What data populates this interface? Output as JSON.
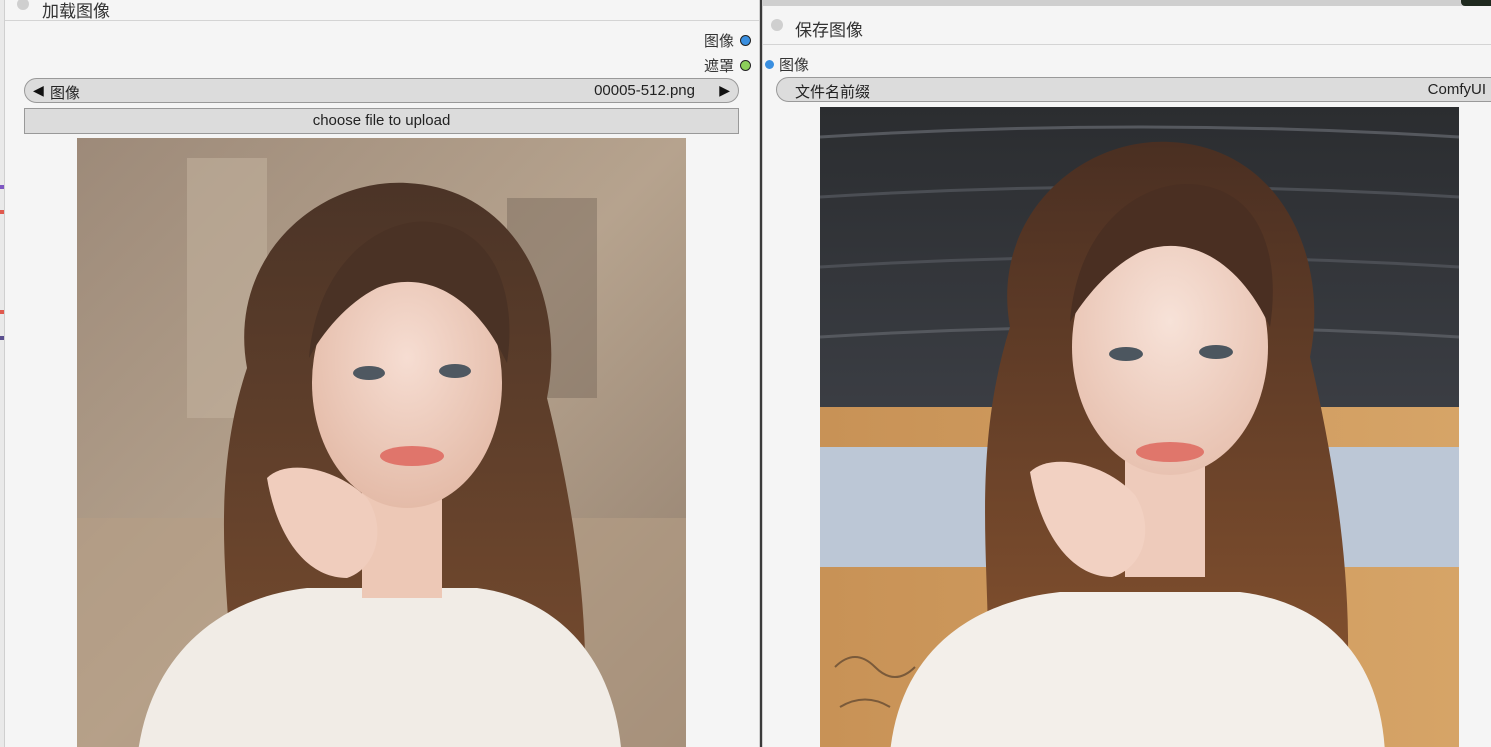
{
  "load_node": {
    "title": "加载图像",
    "outputs": [
      {
        "label": "图像",
        "color": "#3a8fe0"
      },
      {
        "label": "遮罩",
        "color": "#8ccf5a"
      }
    ],
    "image_combo": {
      "label": "图像",
      "value": "00005-512.png"
    },
    "upload_label": "choose file to upload"
  },
  "save_node": {
    "title": "保存图像",
    "input": {
      "label": "图像",
      "color": "#3a8fe0"
    },
    "prefix_widget": {
      "label": "文件名前缀",
      "value": "ComfyUI"
    }
  },
  "colors": {
    "node_bg": "#f5f5f5",
    "widget_bg": "#dcdcdc",
    "image_slot": "#3a8fe0",
    "mask_slot": "#8ccf5a"
  },
  "icons": {
    "prev": "triangle-left-icon",
    "next": "triangle-right-icon",
    "collapse": "collapse-dot-icon"
  }
}
